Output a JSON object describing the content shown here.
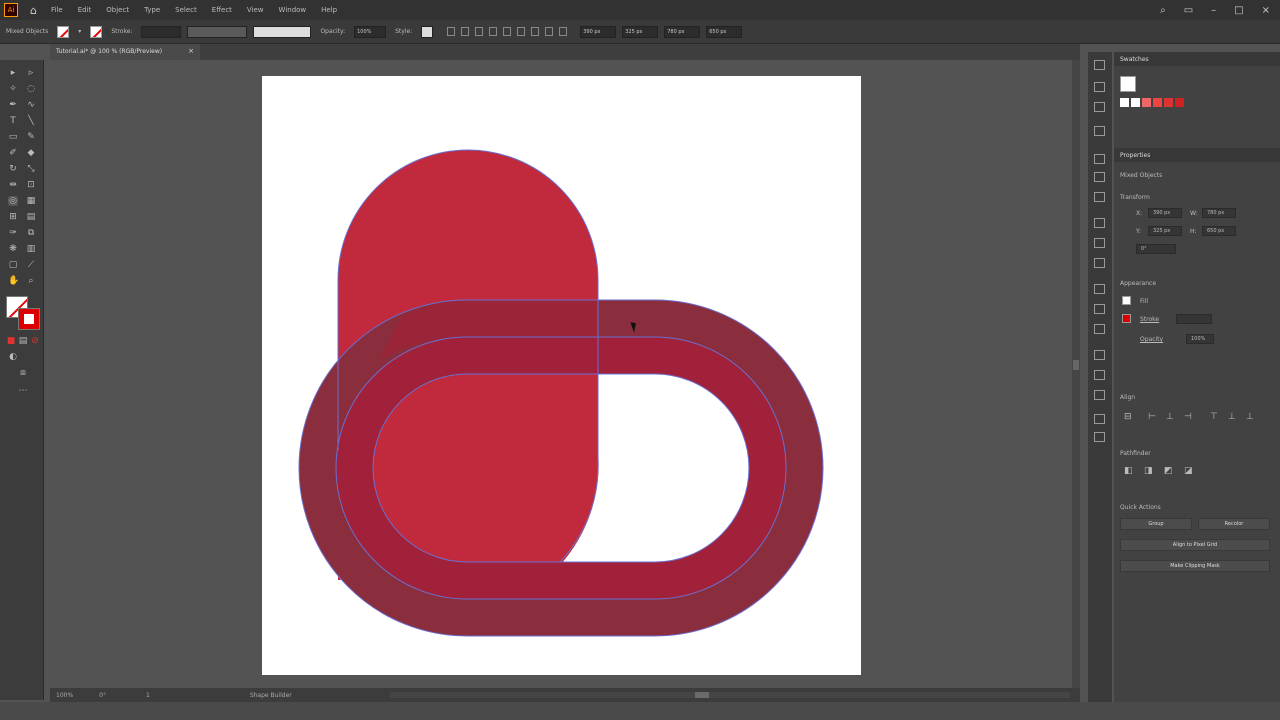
{
  "menubar": {
    "app_logo": "Ai",
    "home_icon": "home-icon",
    "items": [
      "File",
      "Edit",
      "Object",
      "Type",
      "Select",
      "Effect",
      "View",
      "Window",
      "Help"
    ]
  },
  "control": {
    "selection_label": "Mixed Objects",
    "stroke_label": "Stroke:",
    "opacity_label": "Opacity:",
    "opacity_value": "100%",
    "style_label": "Style:",
    "x_value": "390 px",
    "y_value": "325 px",
    "w_value": "780 px",
    "h_value": "650 px"
  },
  "document": {
    "tab_title": "Tutorial.ai* @ 100 % (RGB/Preview)",
    "close": "×"
  },
  "status": {
    "zoom": "100%",
    "rotation": "0°",
    "artboard": "1",
    "tool": "Shape Builder"
  },
  "panels": {
    "swatches_title": "Swatches",
    "properties_title": "Properties",
    "selection_type": "Mixed Objects",
    "transform_label": "Transform",
    "transform": {
      "x_label": "X:",
      "x": "390 px",
      "y_label": "Y:",
      "y": "325 px",
      "w_label": "W:",
      "w": "780 px",
      "h_label": "H:",
      "h": "650 px",
      "angle": "0°"
    },
    "appearance_label": "Appearance",
    "fill_label": "Fill",
    "stroke_label": "Stroke",
    "opacity_label": "Opacity",
    "opacity_value": "100%",
    "align_label": "Align",
    "pathfinder_label": "Pathfinder",
    "quick_actions_label": "Quick Actions",
    "group_button": "Group",
    "recolor_button": "Recolor",
    "align_pixel_button": "Align to Pixel Grid",
    "clipping_mask_button": "Make Clipping Mask"
  },
  "colors": {
    "shape_red": "#c02a3c",
    "ring_outer": "#8a2e3e",
    "ring_inner": "#a2213a",
    "path_blue": "#6a6fd0"
  }
}
